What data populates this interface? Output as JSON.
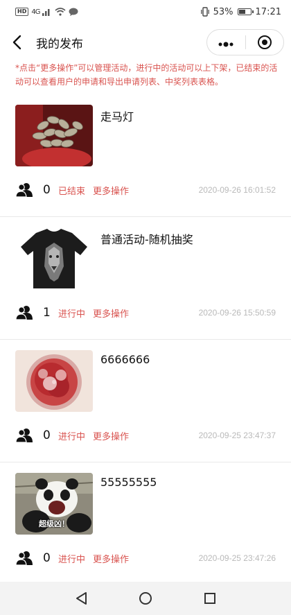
{
  "status_bar": {
    "left_badge": "HD",
    "signal": "4G",
    "battery_percent": "53%",
    "battery_level": 0.53,
    "time": "17:21"
  },
  "nav": {
    "title": "我的发布",
    "more_icon": "more-dots-icon",
    "target_icon": "target-icon"
  },
  "notice": "*点击“更多操作”可以管理活动，进行中的活动可以上下架，已结束的活动可以查看用户的申请和导出申请列表、中奖列表表格。",
  "colors": {
    "accent": "#d9534f",
    "muted": "#b9b9b9"
  },
  "items": [
    {
      "title": "走马灯",
      "count": "0",
      "status": "已结束",
      "action": "更多操作",
      "time": "2020-09-26 16:01:52",
      "image": "succulent-plant-photo"
    },
    {
      "title": "普通活动-随机抽奖",
      "count": "1",
      "status": "进行中",
      "action": "更多操作",
      "time": "2020-09-26 15:50:59",
      "image": "wolf-tshirt-photo"
    },
    {
      "title": "6666666",
      "count": "0",
      "status": "进行中",
      "action": "更多操作",
      "time": "2020-09-25 23:47:37",
      "image": "red-carnation-photo"
    },
    {
      "title": "55555555",
      "count": "0",
      "status": "进行中",
      "action": "更多操作",
      "time": "2020-09-25 23:47:26",
      "image": "panda-meme-photo",
      "image_caption": "超级凶！"
    }
  ]
}
